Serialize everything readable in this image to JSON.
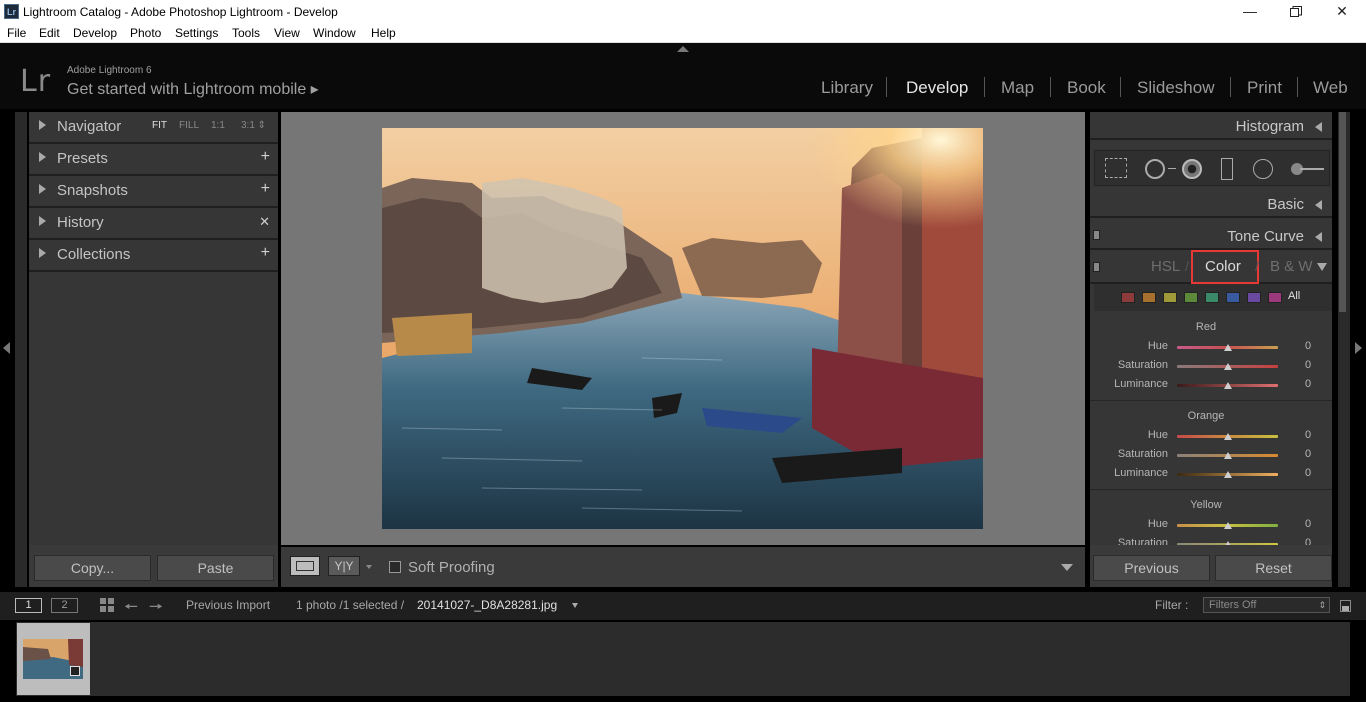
{
  "window": {
    "title": "Lightroom Catalog - Adobe Photoshop Lightroom - Develop",
    "app_icon": "Lr",
    "controls": [
      "minimize-icon",
      "restore-icon",
      "close-icon"
    ]
  },
  "menu": [
    "File",
    "Edit",
    "Develop",
    "Photo",
    "Settings",
    "Tools",
    "View",
    "Window",
    "Help"
  ],
  "identity": {
    "logo": "Lr",
    "product": "Adobe Lightroom 6",
    "mobile_prompt": "Get started with Lightroom mobile ▸"
  },
  "modules": [
    "Library",
    "Develop",
    "Map",
    "Book",
    "Slideshow",
    "Print",
    "Web"
  ],
  "active_module": "Develop",
  "left_panel": {
    "navigator": {
      "label": "Navigator",
      "modes": [
        "FIT",
        "FILL",
        "1:1",
        "3:1 ⇕"
      ]
    },
    "presets": {
      "label": "Presets",
      "action": "+"
    },
    "snapshots": {
      "label": "Snapshots",
      "action": "+"
    },
    "history": {
      "label": "History",
      "action": "✕"
    },
    "collections": {
      "label": "Collections",
      "action": "+"
    },
    "copy_button": "Copy...",
    "paste_button": "Paste"
  },
  "toolbar": {
    "soft_proofing": "Soft Proofing",
    "compare_label": "Y|Y"
  },
  "right_panel": {
    "histogram": "Histogram",
    "basic": "Basic",
    "tone_curve": "Tone Curve",
    "tabs": [
      "HSL",
      "Color",
      "B & W"
    ],
    "active_tab": "Color",
    "swatch_all": "All",
    "swatch_colors": [
      "#8c3a3a",
      "#a8702e",
      "#a0993a",
      "#5c8a3a",
      "#3a8a6a",
      "#3a5aa0",
      "#6a4aa0",
      "#9a3a7a"
    ],
    "groups": [
      {
        "name": "Red",
        "sliders": [
          {
            "label": "Hue",
            "value": "0",
            "gradient": "linear-gradient(90deg,#c85a8a,#c85050,#c8a050)"
          },
          {
            "label": "Saturation",
            "value": "0",
            "gradient": "linear-gradient(90deg,#8a7a7a,#c84040)"
          },
          {
            "label": "Luminance",
            "value": "0",
            "gradient": "linear-gradient(90deg,#3a1a1a,#e07070)"
          }
        ]
      },
      {
        "name": "Orange",
        "sliders": [
          {
            "label": "Hue",
            "value": "0",
            "gradient": "linear-gradient(90deg,#c84a4a,#c88a40,#c8c040)"
          },
          {
            "label": "Saturation",
            "value": "0",
            "gradient": "linear-gradient(90deg,#8a8278,#d88a30)"
          },
          {
            "label": "Luminance",
            "value": "0",
            "gradient": "linear-gradient(90deg,#3a2a10,#f0b060)"
          }
        ]
      },
      {
        "name": "Yellow",
        "sliders": [
          {
            "label": "Hue",
            "value": "0",
            "gradient": "linear-gradient(90deg,#c8904a,#c8c040,#80b040)"
          },
          {
            "label": "Saturation",
            "value": "0",
            "gradient": "linear-gradient(90deg,#888878,#d0c840)"
          }
        ]
      }
    ],
    "previous_button": "Previous",
    "reset_button": "Reset"
  },
  "filmstrip": {
    "page1": "1",
    "page2": "2",
    "source": "Previous Import",
    "count": "1 photo /1 selected /",
    "filename": "20141027-_D8A28281.jpg",
    "filter_label": "Filter :",
    "filter_value": "Filters Off"
  },
  "colors": {
    "highlight_box": "#e53935",
    "panel_bg": "#363636",
    "center_bg": "#767676"
  }
}
